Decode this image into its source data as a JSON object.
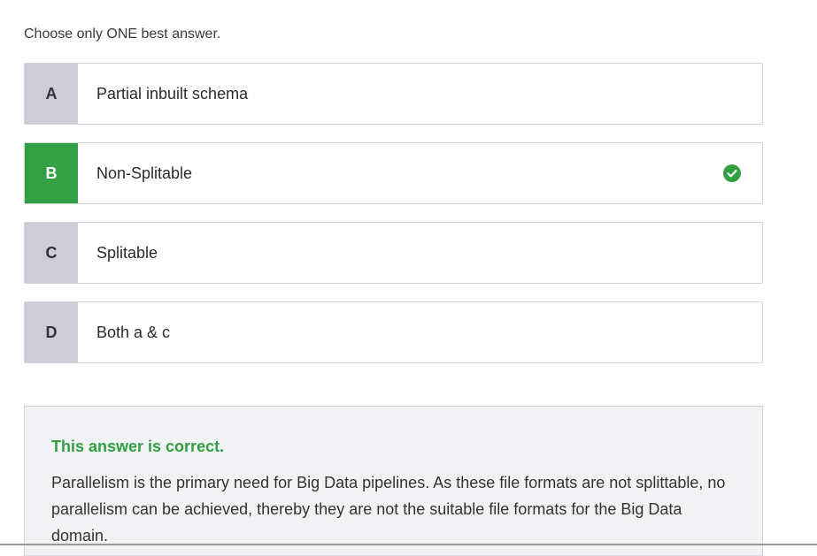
{
  "instruction": "Choose only ONE best answer.",
  "options": [
    {
      "letter": "A",
      "text": "Partial inbuilt schema",
      "selected": false
    },
    {
      "letter": "B",
      "text": "Non-Splitable",
      "selected": true
    },
    {
      "letter": "C",
      "text": "Splitable",
      "selected": false
    },
    {
      "letter": "D",
      "text": "Both a & c",
      "selected": false
    }
  ],
  "feedback": {
    "title": "This answer is correct.",
    "body": "Parallelism is the primary need for Big Data pipelines. As these file formats are not splittable, no parallelism can be achieved, thereby they are not the suitable file formats for the Big Data domain."
  },
  "icons": {
    "correct": "check-circle-icon"
  },
  "colors": {
    "correct": "#32a043",
    "letter_bg": "#ccced6"
  }
}
